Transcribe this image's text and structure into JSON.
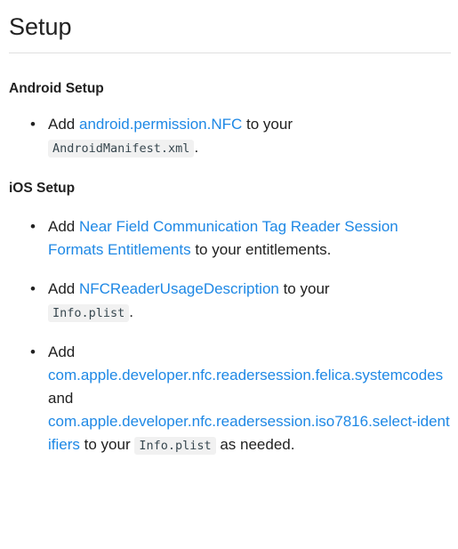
{
  "title": "Setup",
  "android": {
    "heading": "Android Setup",
    "item1": {
      "prefix": "Add ",
      "link": "android.permission.NFC",
      "middle": " to your",
      "code": "AndroidManifest.xml",
      "suffix": "."
    }
  },
  "ios": {
    "heading": "iOS Setup",
    "item1": {
      "prefix": "Add ",
      "link": "Near Field Communication Tag Reader Session Formats Entitlements",
      "suffix": " to your entitlements."
    },
    "item2": {
      "prefix": "Add ",
      "link": "NFCReaderUsageDescription",
      "middle": " to your",
      "code": "Info.plist",
      "suffix": "."
    },
    "item3": {
      "prefix": "Add",
      "link1": "com.apple.developer.nfc.readersession.felica.systemcodes",
      "and": " and",
      "link2": "com.apple.developer.nfc.readersession.iso7816.select-identifiers",
      "middle": " to your ",
      "code": "Info.plist",
      "suffix": " as needed."
    }
  }
}
